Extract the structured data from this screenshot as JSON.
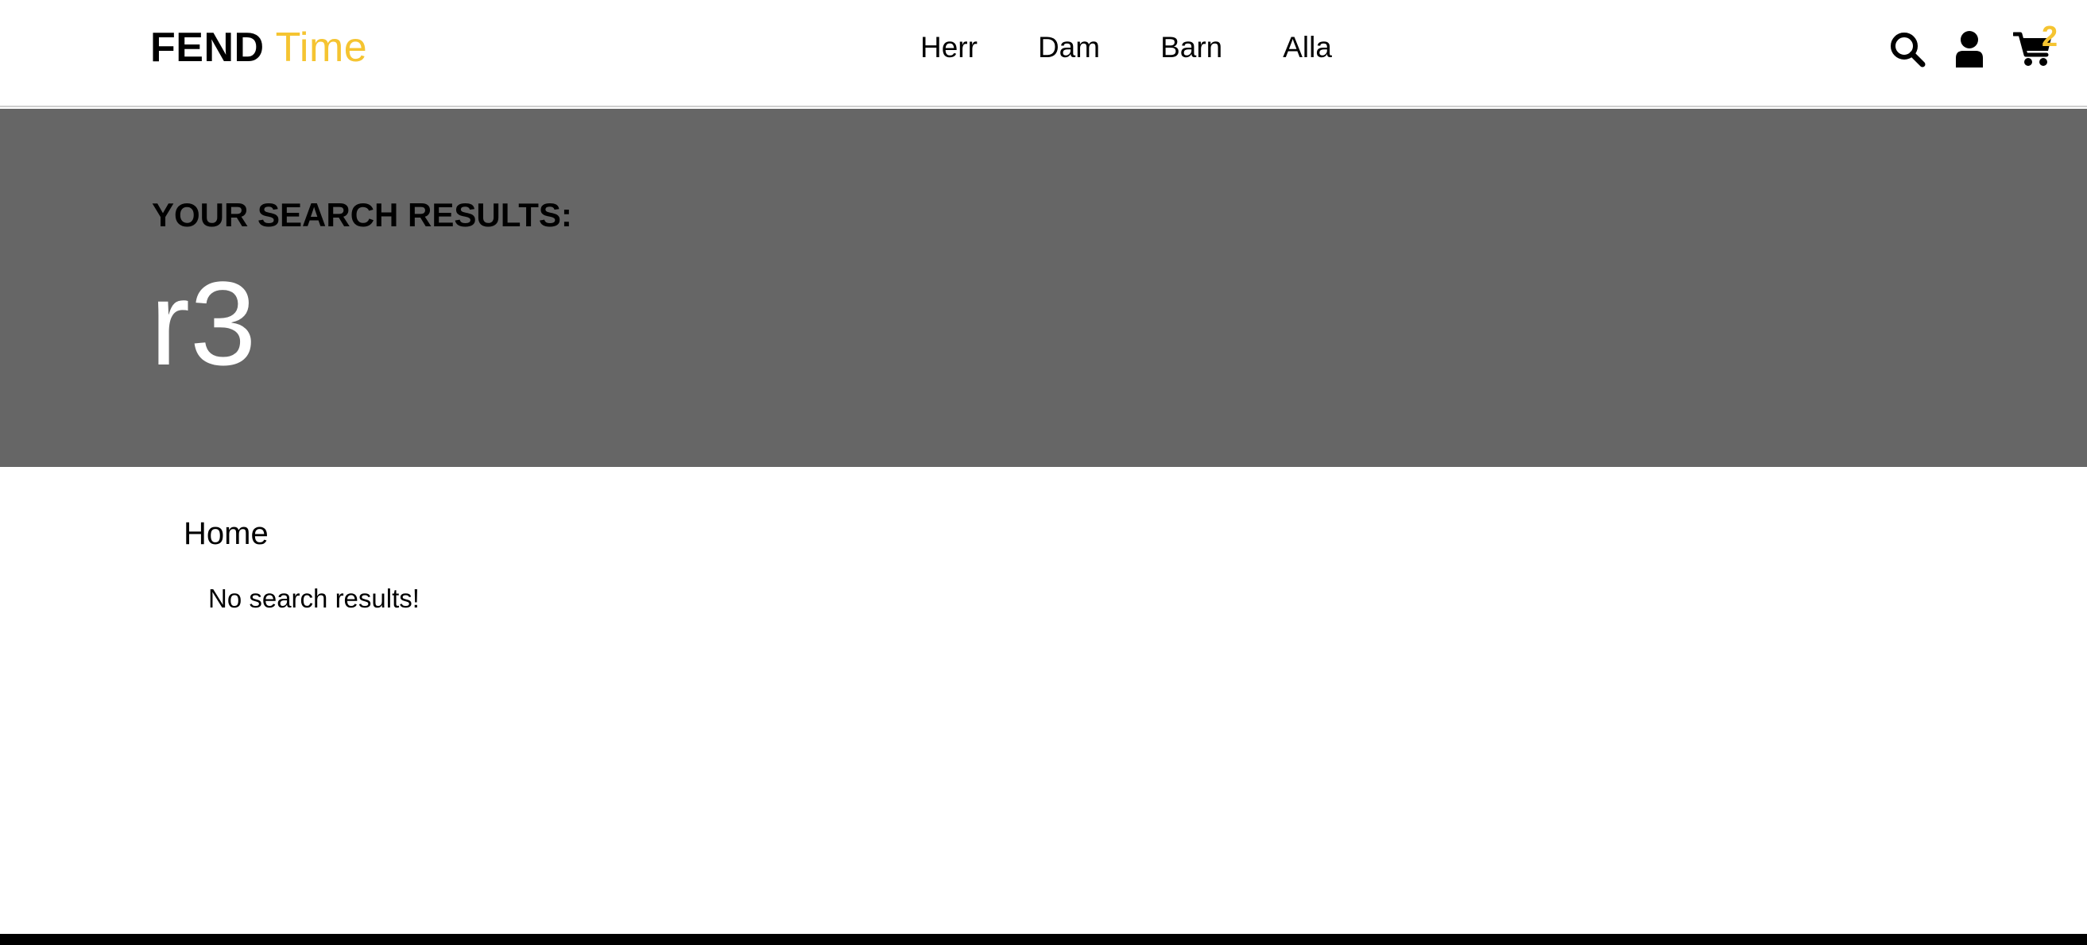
{
  "header": {
    "logo": {
      "brand": "FEND",
      "accent": "Time"
    },
    "nav": [
      {
        "label": "Herr"
      },
      {
        "label": "Dam"
      },
      {
        "label": "Barn"
      },
      {
        "label": "Alla"
      }
    ],
    "icons": {
      "search": "search-icon",
      "account": "user-icon",
      "cart": "cart-icon"
    },
    "cart_count": "2"
  },
  "banner": {
    "heading": "YOUR SEARCH RESULTS:",
    "query": "r3"
  },
  "breadcrumb": {
    "home": "Home"
  },
  "results": {
    "empty_message": "No search results!"
  },
  "colors": {
    "accent": "#f5c431",
    "banner_bg": "#666666",
    "footer": "#000000"
  }
}
